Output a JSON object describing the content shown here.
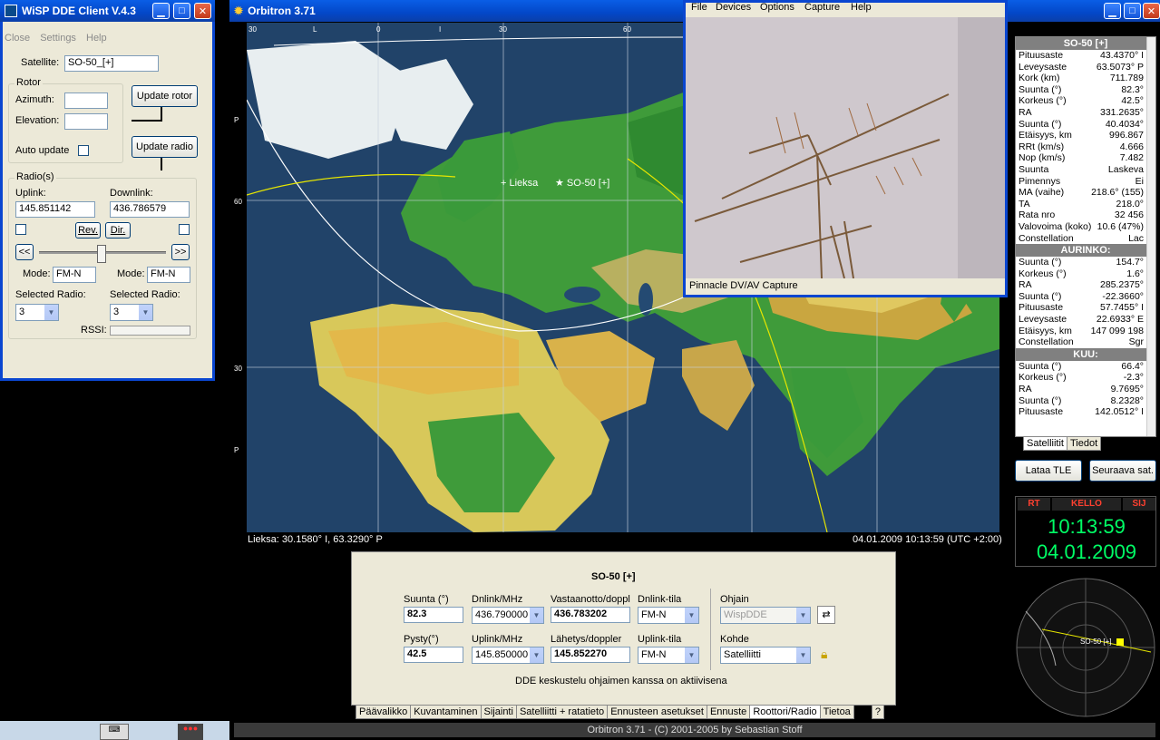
{
  "wisp": {
    "title": "WiSP DDE Client V.4.3",
    "menu": [
      "Close",
      "Settings",
      "Help"
    ],
    "satellite_label": "Satellite:",
    "satellite_value": "SO-50_[+]",
    "rotor_label": "Rotor",
    "azimuth_label": "Azimuth:",
    "elevation_label": "Elevation:",
    "update_rotor": "Update rotor",
    "auto_update": "Auto update",
    "update_radio": "Update radio",
    "radios_label": "Radio(s)",
    "uplink_label": "Uplink:",
    "uplink_value": "145.851142",
    "downlink_label": "Downlink:",
    "downlink_value": "436.786579",
    "rev": "Rev.",
    "dir": "Dir.",
    "left_btn": "<<",
    "right_btn": ">>",
    "mode_label": "Mode:",
    "mode_left": "FM-N",
    "mode_right": "FM-N",
    "selected_radio_label": "Selected Radio:",
    "radio_left": "3",
    "radio_right": "3",
    "rssi_label": "RSSI:"
  },
  "orbitron": {
    "title": "Orbitron 3.71",
    "top_axis": [
      "30",
      "L",
      "0",
      "I",
      "30",
      "60"
    ],
    "left_axis": [
      "P",
      "60",
      "30",
      "P"
    ],
    "lieksa_label": "Lieksa",
    "sat_label": "SO-50 [+]",
    "status_left": "Lieksa: 30.1580° I, 63.3290° P",
    "status_right": "04.01.2009 10:13:59 (UTC +2:00)",
    "footer": "Orbitron 3.71 - (C) 2001-2005 by Sebastian Stoff",
    "tabs": [
      "Päävalikko",
      "Kuvantaminen",
      "Sijainti",
      "Satelliitti + ratatieto",
      "Ennusteen asetukset",
      "Ennuste",
      "Roottori/Radio",
      "Tietoa",
      "?"
    ],
    "radio_panel": {
      "title": "SO-50 [+]",
      "suunta_label": "Suunta (°)",
      "suunta_value": "82.3",
      "pysty_label": "Pysty(°)",
      "pysty_value": "42.5",
      "dnlink_label": "Dnlink/MHz",
      "dnlink_value": "436.790000",
      "uplink_label": "Uplink/MHz",
      "uplink_value": "145.850000",
      "vastaanotto_label": "Vastaanotto/doppl",
      "vastaanotto_value": "436.783202",
      "lahetys_label": "Lähetys/doppler",
      "lahetys_value": "145.852270",
      "dnlink_tila_label": "Dnlink-tila",
      "dnlink_tila_value": "FM-N",
      "uplink_tila_label": "Uplink-tila",
      "uplink_tila_value": "FM-N",
      "ohjain_label": "Ohjain",
      "ohjain_value": "WispDDE",
      "kohde_label": "Kohde",
      "kohde_value": "Satelliitti",
      "status": "DDE keskustelu ohjaimen kanssa on aktiivisena"
    },
    "info": {
      "header": "SO-50 [+]",
      "sat_rows": [
        [
          "Pituusaste",
          "43.4370° I"
        ],
        [
          "Leveysaste",
          "63.5073° P"
        ],
        [
          "Kork (km)",
          "711.789"
        ],
        [
          "Suunta (°)",
          "82.3°"
        ],
        [
          "Korkeus (°)",
          "42.5°"
        ],
        [
          "RA",
          "331.2635°"
        ],
        [
          "Suunta (°)",
          "40.4034°"
        ],
        [
          "Etäisyys, km",
          "996.867"
        ],
        [
          "RRt (km/s)",
          "4.666"
        ],
        [
          "Nop (km/s)",
          "7.482"
        ],
        [
          "Suunta",
          "Laskeva"
        ],
        [
          "Pimennys",
          "Ei"
        ],
        [
          "MA (vaihe)",
          "218.6° (155)"
        ],
        [
          "TA",
          "218.0°"
        ],
        [
          "Rata nro",
          "32 456"
        ],
        [
          "Valovoima (koko)",
          "10.6 (47%)"
        ],
        [
          "Constellation",
          "Lac"
        ]
      ],
      "sun_header": "AURINKO:",
      "sun_rows": [
        [
          "Suunta (°)",
          "154.7°"
        ],
        [
          "Korkeus (°)",
          "1.6°"
        ],
        [
          "RA",
          "285.2375°"
        ],
        [
          "Suunta (°)",
          "-22.3660°"
        ],
        [
          "Pituusaste",
          "57.7455° I"
        ],
        [
          "Leveysaste",
          "22.6933° E"
        ],
        [
          "Etäisyys, km",
          "147 099 198"
        ],
        [
          "Constellation",
          "Sgr"
        ]
      ],
      "moon_header": "KUU:",
      "moon_rows": [
        [
          "Suunta (°)",
          "66.4°"
        ],
        [
          "Korkeus (°)",
          "-2.3°"
        ],
        [
          "RA",
          "9.7695°"
        ],
        [
          "Suunta (°)",
          "8.2328°"
        ],
        [
          "Pituusaste",
          "142.0512° I"
        ]
      ],
      "tabs": [
        "Satelliitit",
        "Tiedot"
      ]
    },
    "lataa_tle": "Lataa TLE",
    "seuraava": "Seuraava sat.",
    "clock": {
      "rt": "RT",
      "kello": "KELLO",
      "sij": "SIJ",
      "time": "10:13:59",
      "date": "04.01.2009"
    },
    "radar_label": "SO-50 [+]"
  },
  "capture": {
    "menu": [
      "File",
      "Devices",
      "Options",
      "Capture",
      "Help"
    ],
    "status": "Pinnacle DV/AV Capture"
  }
}
